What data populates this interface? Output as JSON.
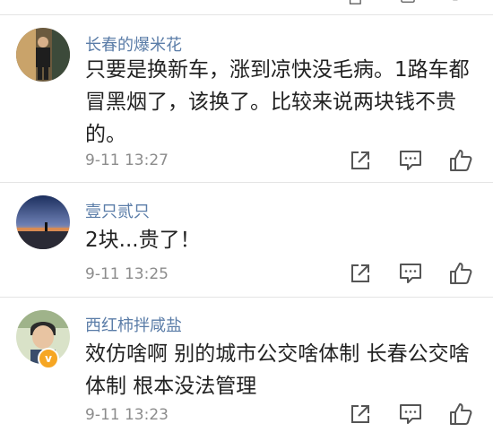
{
  "comments": [
    {
      "username": "长春的爆米花",
      "content": "只要是换新车，涨到凉快没毛病。1路车都冒黑烟了，该换了。比较来说两块钱不贵的。",
      "time": "9-11 13:27"
    },
    {
      "username": "壹只贰只",
      "content": "2块...贵了！",
      "time": "9-11 13:25"
    },
    {
      "username": "西红柿拌咸盐",
      "content": "效仿啥啊 别的城市公交啥体制 长春公交啥体制 根本没法管理",
      "time": "9-11 13:23",
      "badge": "v"
    }
  ],
  "icons": {
    "action_1": "share-icon",
    "action_2": "comment-icon",
    "action_3": "like-icon"
  },
  "colors": {
    "username": "#5b7da8",
    "icon": "#555555",
    "badge": "#f6a623"
  }
}
